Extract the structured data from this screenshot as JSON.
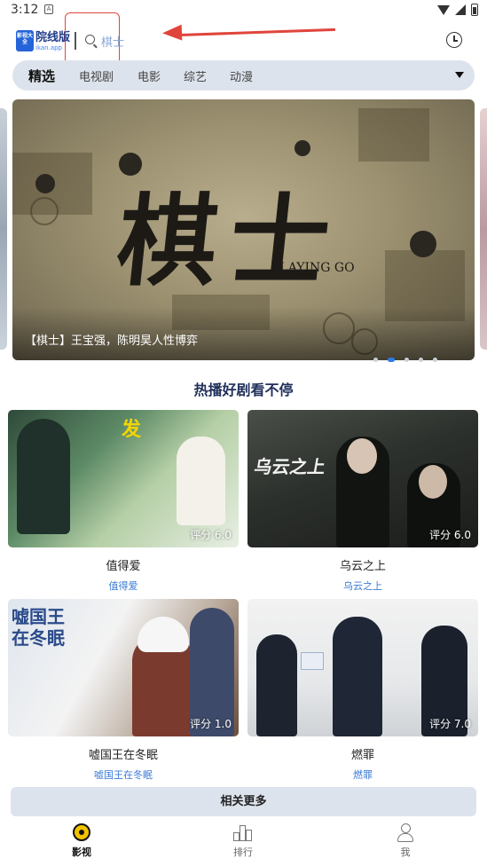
{
  "status_bar": {
    "time": "3:12",
    "notif_letter": "A"
  },
  "header": {
    "logo_badge": "影视大全",
    "logo_title": "院线版",
    "logo_sub": "ikan.app",
    "search_text": "棋士"
  },
  "tabs": [
    {
      "label": "精选",
      "active": true
    },
    {
      "label": "电视剧",
      "active": false
    },
    {
      "label": "电影",
      "active": false
    },
    {
      "label": "综艺",
      "active": false
    },
    {
      "label": "动漫",
      "active": false
    }
  ],
  "banner": {
    "title": "棋士",
    "subtitle": "PLAYING GO",
    "caption": "【棋士】王宝强，陈明昊人性博弈",
    "page_count": 5,
    "active_page": 2
  },
  "section_title": "热播好剧看不停",
  "cards": [
    {
      "title": "值得爱",
      "subtitle": "值得爱",
      "score": "评分 6.0"
    },
    {
      "title": "乌云之上",
      "subtitle": "乌云之上",
      "score": "评分 6.0"
    },
    {
      "title": "嘘国王在冬眠",
      "subtitle": "嘘国王在冬眠",
      "score": "评分 1.0"
    },
    {
      "title": "燃罪",
      "subtitle": "燃罪",
      "score": "评分 7.0"
    }
  ],
  "more_button": "相关更多",
  "bottom_nav": [
    {
      "label": "影视",
      "active": true
    },
    {
      "label": "排行",
      "active": false
    },
    {
      "label": "我",
      "active": false
    }
  ],
  "colors": {
    "accent": "#2f7be6",
    "annotation": "#e0453c",
    "tab_bg": "#dde3ec"
  }
}
